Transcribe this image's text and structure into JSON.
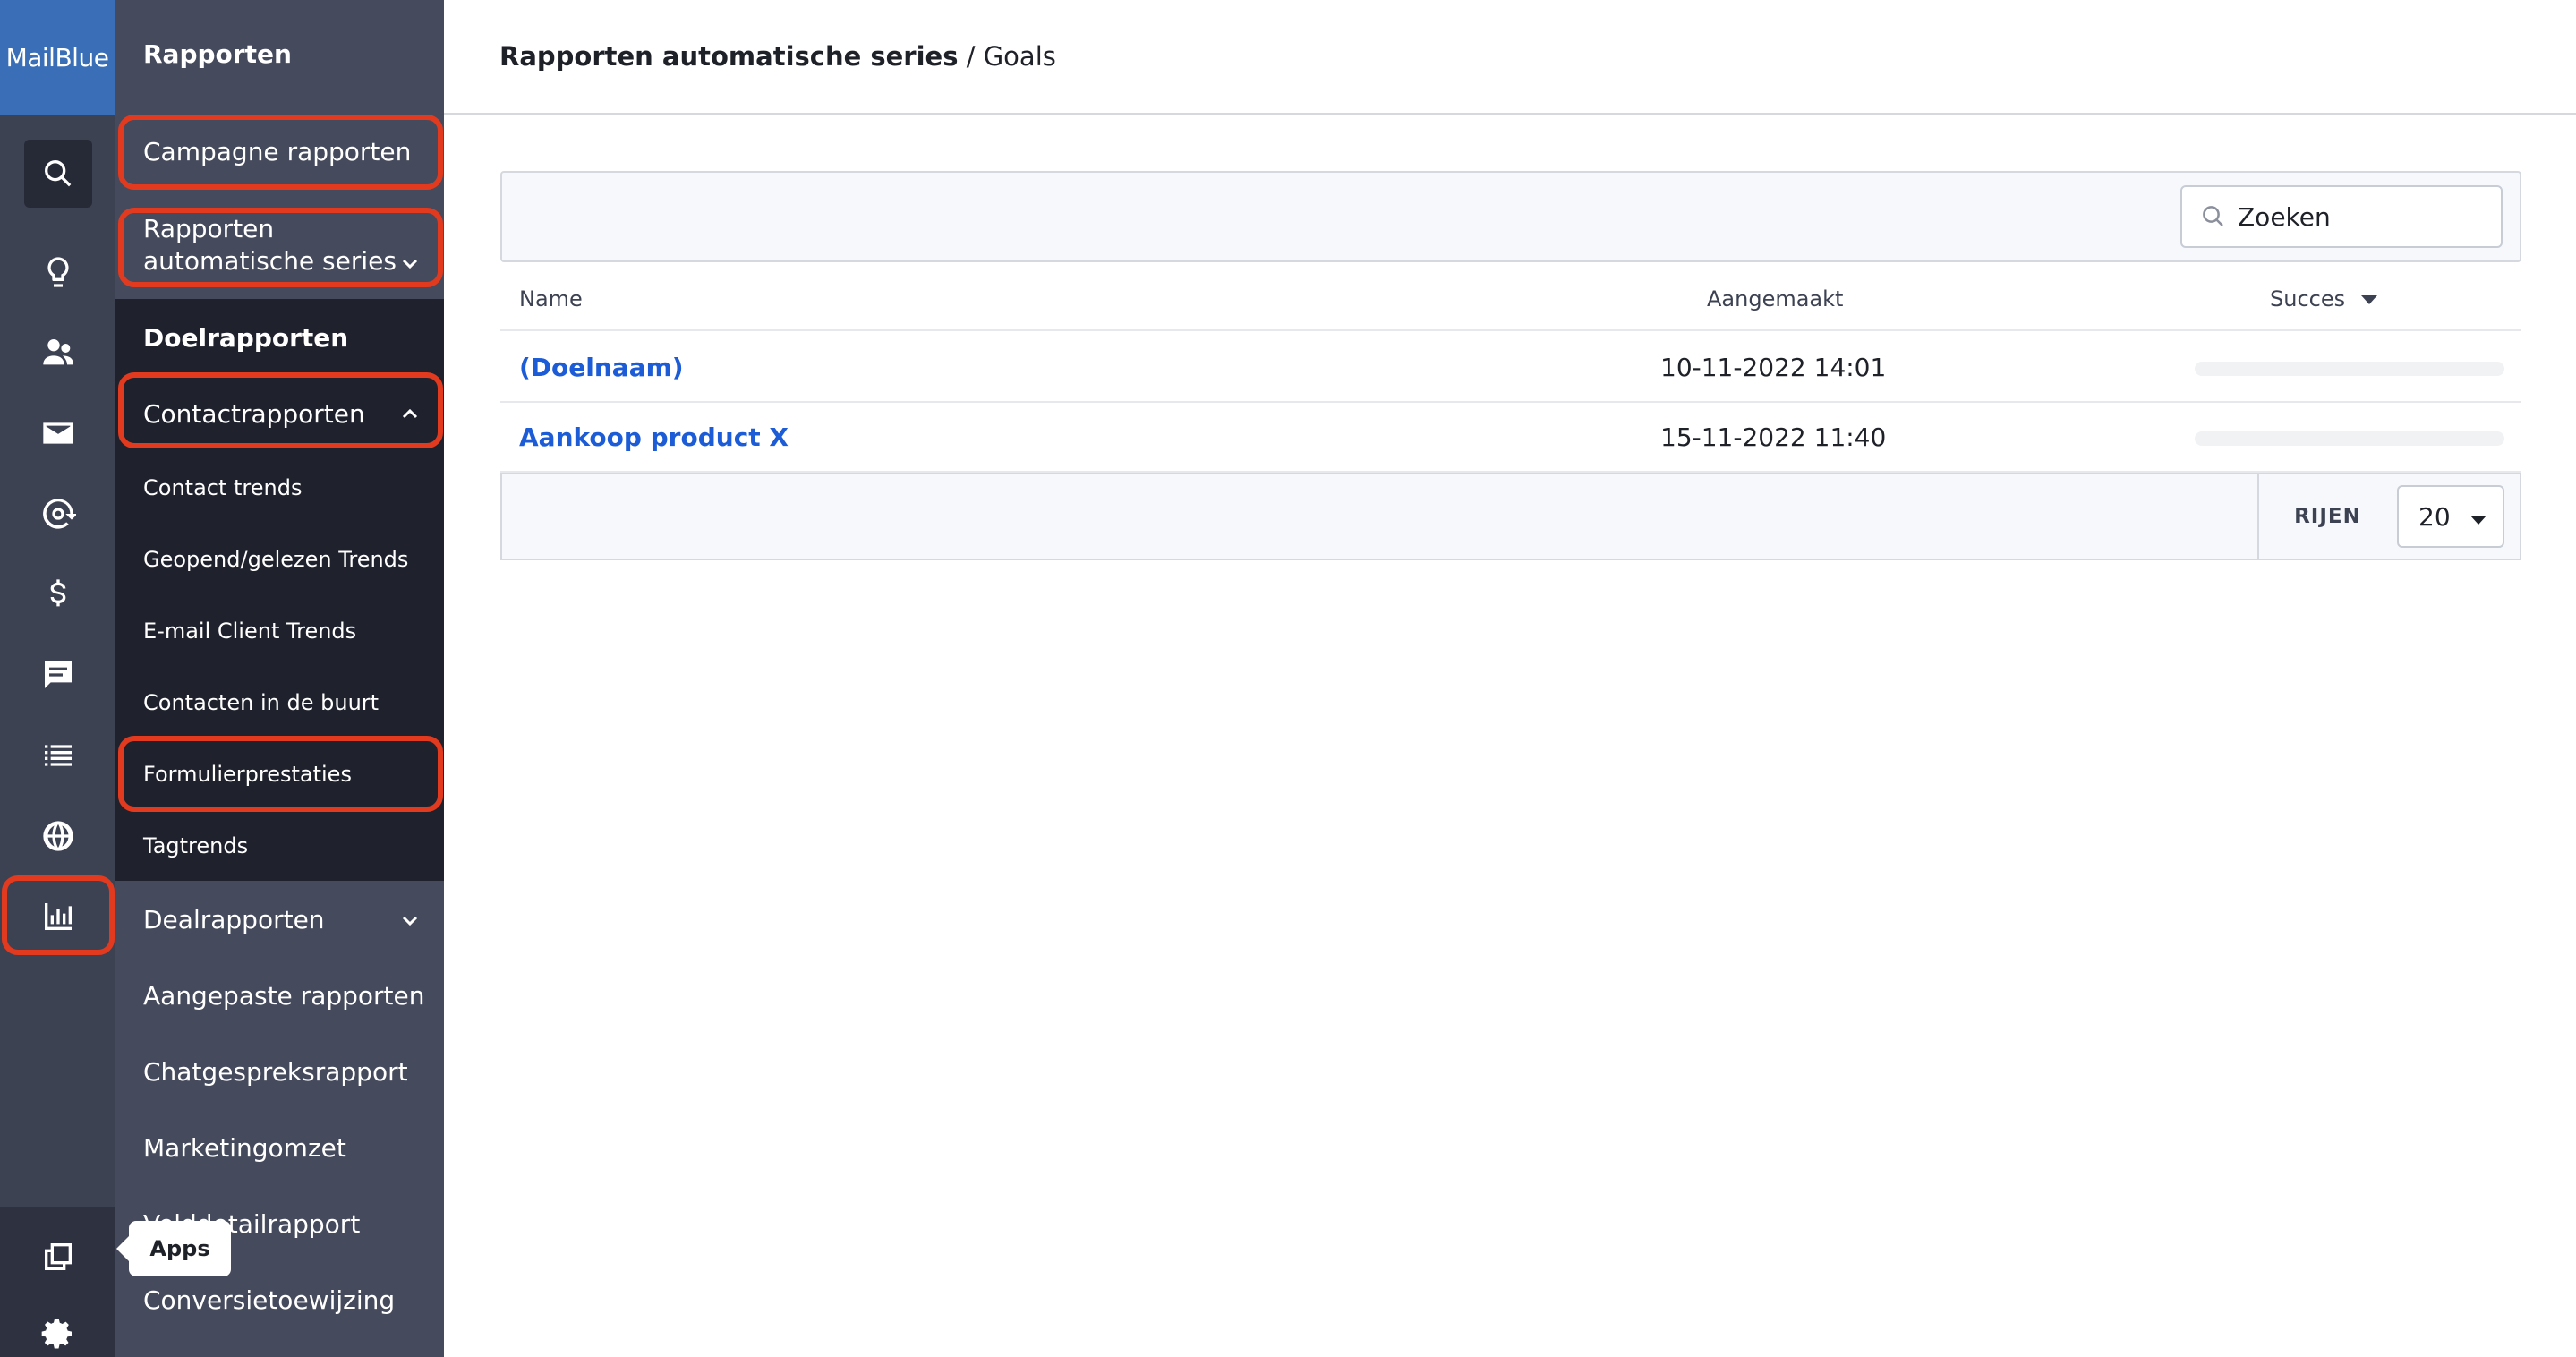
{
  "brand": "MailBlue",
  "sidebar": {
    "heading": "Rapporten",
    "items": {
      "campagne": "Campagne rapporten",
      "automatisch_1": "Rapporten",
      "automatisch_2": "automatische series",
      "doel": "Doelrapporten",
      "contact": "Contactrapporten",
      "sub": [
        "Contact trends",
        "Geopend/gelezen Trends",
        "E-mail Client Trends",
        "Contacten in de buurt",
        "Formulierprestaties",
        "Tagtrends"
      ],
      "deal": "Dealrapporten",
      "aangepast": "Aangepaste rapporten",
      "chat": "Chatgespreksrapport",
      "marketing": "Marketingomzet",
      "veld": "Velddetailrapport",
      "conversie": "Conversietoewijzing"
    }
  },
  "tooltip": "Apps",
  "breadcrumb": {
    "parent": "Rapporten automatische series",
    "sep": " / ",
    "current": "Goals"
  },
  "search": {
    "value": "Zoeken"
  },
  "table": {
    "headers": {
      "name": "Name",
      "created": "Aangemaakt",
      "success": "Succes"
    },
    "rows": [
      {
        "name": "(Doelnaam)",
        "created": "10-11-2022 14:01"
      },
      {
        "name": "Aankoop product X",
        "created": "15-11-2022 11:40"
      }
    ]
  },
  "pagination": {
    "rows_label": "RIJEN",
    "rows_value": "20"
  },
  "icons": [
    "search-icon",
    "lightbulb-icon",
    "contacts-icon",
    "envelope-icon",
    "automation-icon",
    "dollar-icon",
    "chat-icon",
    "list-icon",
    "globe-icon",
    "bar-chart-icon",
    "apps-icon",
    "gear-icon"
  ],
  "colors": {
    "highlight": "#e23a1f",
    "link": "#1c5cd6",
    "brand": "#3a6fb7"
  }
}
